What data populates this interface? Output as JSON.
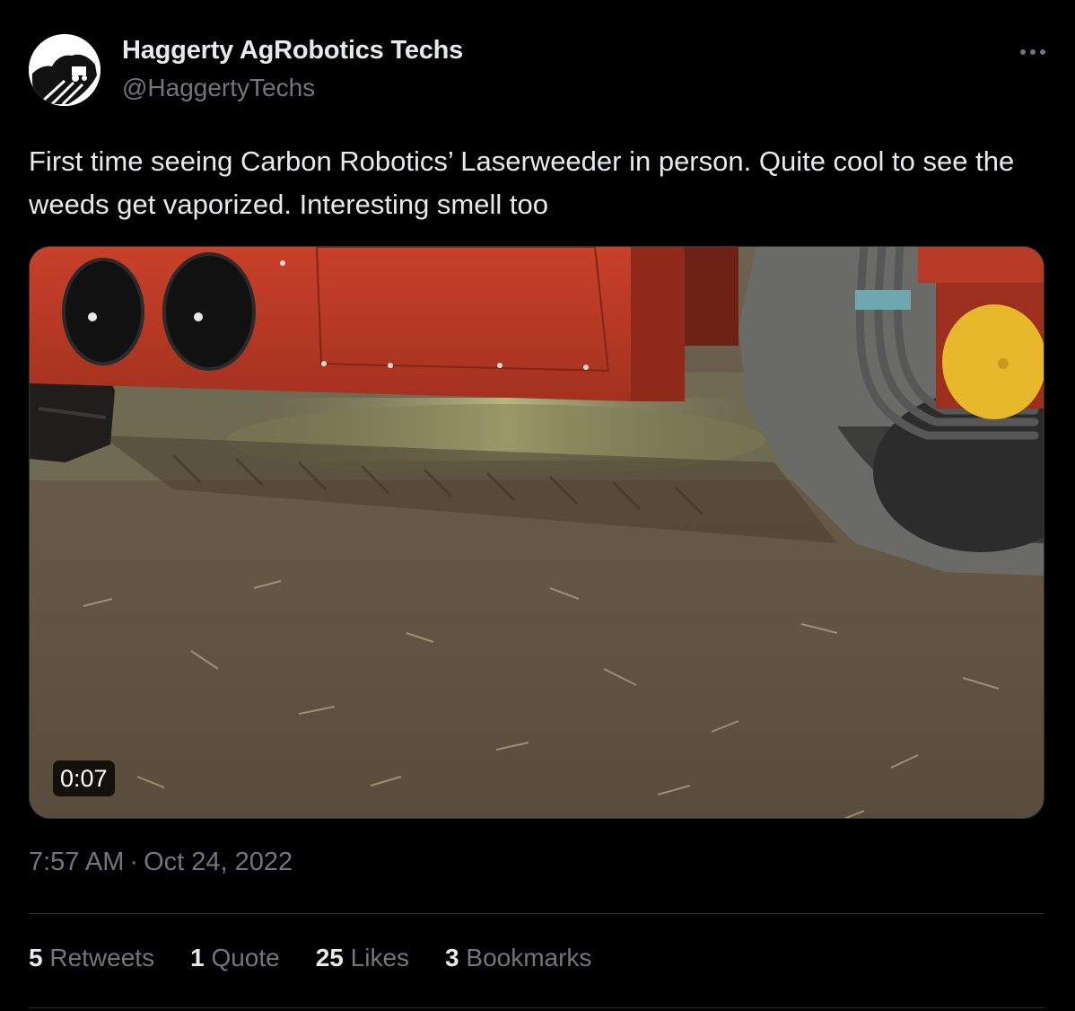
{
  "author": {
    "display_name": "Haggerty AgRobotics Techs",
    "handle": "@HaggertyTechs",
    "avatar_icon": "farm-tractor-logo-icon"
  },
  "more_icon": "more-horizontal-icon",
  "tweet": {
    "text": "First time seeing Carbon Robotics’ Laserweeder in person. Quite cool to see the weeds get vaporized. Interesting smell too"
  },
  "media": {
    "type": "video",
    "duration": "0:07"
  },
  "posted": {
    "time": "7:57 AM",
    "separator": "·",
    "date": "Oct 24, 2022"
  },
  "stats": [
    {
      "count": "5",
      "label": "Retweets"
    },
    {
      "count": "1",
      "label": "Quote"
    },
    {
      "count": "25",
      "label": "Likes"
    },
    {
      "count": "3",
      "label": "Bookmarks"
    }
  ],
  "colors": {
    "background": "#000000",
    "primary_text": "#e7e9ea",
    "secondary_text": "#71767b",
    "divider": "#2f3336"
  }
}
